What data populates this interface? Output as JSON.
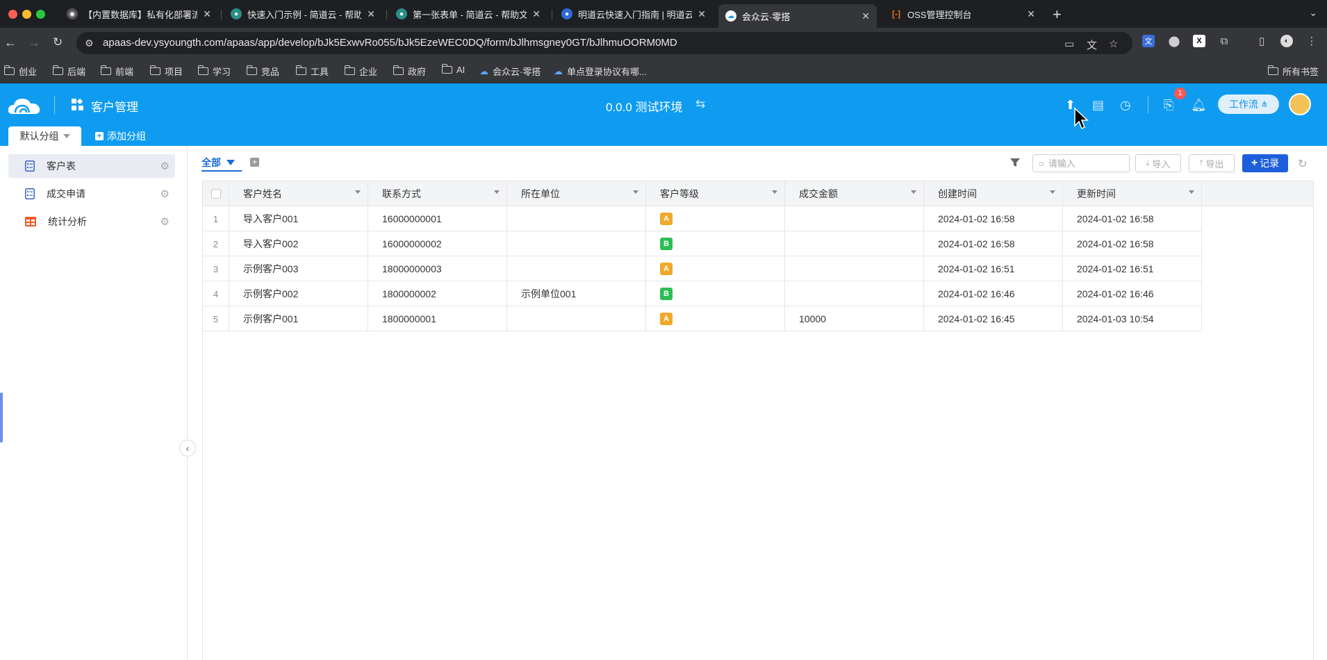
{
  "browser": {
    "tabs": [
      {
        "title": "【内置数据库】私有化部署流程",
        "active": false
      },
      {
        "title": "快速入门示例 - 简道云 - 帮助文",
        "active": false
      },
      {
        "title": "第一张表单 - 简道云 - 帮助文档",
        "active": false
      },
      {
        "title": "明道云快速入门指南 | 明道云",
        "active": false
      },
      {
        "title": "会众云·零搭",
        "active": true
      },
      {
        "title": "OSS管理控制台",
        "active": false
      }
    ],
    "url": "apaas-dev.ysyoungth.com/apaas/app/develop/bJk5ExwvRo055/bJk5EzeWEC0DQ/form/bJlhmsgney0GT/bJlhmuOORM0MD",
    "bookmarks": [
      "创业",
      "后端",
      "前端",
      "项目",
      "学习",
      "竞品",
      "工具",
      "企业",
      "政府",
      "AI",
      "会众云·零搭",
      "单点登录协议有哪..."
    ],
    "all_bookmarks": "所有书签"
  },
  "header": {
    "app_name": "客户管理",
    "environment": "0.0.0 测试环境",
    "notification_count": "1",
    "workflow_button": "工作流",
    "group_tabs": {
      "default": "默认分组",
      "add": "添加分组"
    }
  },
  "sidebar": {
    "items": [
      {
        "label": "客户表",
        "active": true
      },
      {
        "label": "成交申请",
        "active": false
      },
      {
        "label": "统计分析",
        "active": false
      }
    ]
  },
  "main": {
    "view_tab": "全部",
    "search_placeholder": "请输入",
    "import_label": "导入",
    "export_label": "导出",
    "record_label": "记录",
    "columns": [
      "客户姓名",
      "联系方式",
      "所在单位",
      "客户等级",
      "成交金额",
      "创建时间",
      "更新时间"
    ],
    "rows": [
      {
        "index": "1",
        "name": "导入客户001",
        "contact": "16000000001",
        "unit": "",
        "level": "A",
        "amount": "",
        "created": "2024-01-02 16:58",
        "updated": "2024-01-02 16:58"
      },
      {
        "index": "2",
        "name": "导入客户002",
        "contact": "16000000002",
        "unit": "",
        "level": "B",
        "amount": "",
        "created": "2024-01-02 16:58",
        "updated": "2024-01-02 16:58"
      },
      {
        "index": "3",
        "name": "示例客户003",
        "contact": "18000000003",
        "unit": "",
        "level": "A",
        "amount": "",
        "created": "2024-01-02 16:51",
        "updated": "2024-01-02 16:51"
      },
      {
        "index": "4",
        "name": "示例客户002",
        "contact": "1800000002",
        "unit": "示例单位001",
        "level": "B",
        "amount": "",
        "created": "2024-01-02 16:46",
        "updated": "2024-01-02 16:46"
      },
      {
        "index": "5",
        "name": "示例客户001",
        "contact": "1800000001",
        "unit": "",
        "level": "A",
        "amount": "10000",
        "created": "2024-01-02 16:45",
        "updated": "2024-01-03 10:54"
      }
    ]
  },
  "colors": {
    "header_blue": "#0f9cf0",
    "primary": "#1d5fdb",
    "level_a": "#f0a92b",
    "level_b": "#2dbd55",
    "badge_red": "#f55"
  }
}
